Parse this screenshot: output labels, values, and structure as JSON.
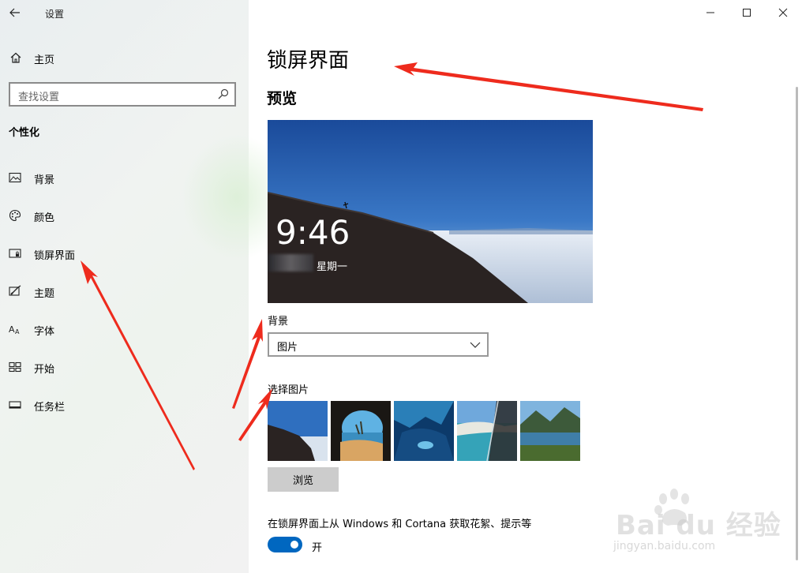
{
  "window": {
    "title": "设置",
    "back_glyph": "←",
    "controls": [
      "minimize-icon",
      "maximize-icon",
      "close-icon"
    ]
  },
  "sidebar": {
    "home_label": "主页",
    "search_placeholder": "查找设置",
    "section_title": "个性化",
    "items": [
      {
        "label": "背景",
        "icon": "picture-icon"
      },
      {
        "label": "颜色",
        "icon": "palette-icon"
      },
      {
        "label": "锁屏界面",
        "icon": "lockscreen-icon"
      },
      {
        "label": "主题",
        "icon": "theme-icon"
      },
      {
        "label": "字体",
        "icon": "font-icon"
      },
      {
        "label": "开始",
        "icon": "start-icon"
      },
      {
        "label": "任务栏",
        "icon": "taskbar-icon"
      }
    ]
  },
  "main": {
    "page_title": "锁屏界面",
    "preview_title": "预览",
    "preview": {
      "time": "9:46",
      "weekday": "星期一"
    },
    "background_label": "背景",
    "background_value": "图片",
    "choose_picture_label": "选择图片",
    "browse_button": "浏览",
    "tips_label": "在锁屏界面上从 Windows 和 Cortana 获取花絮、提示等",
    "tips_toggle_state": "开",
    "tips_toggle_on": true
  },
  "watermark": {
    "text": "Bai du 经验",
    "url": "jingyan.baidu.com"
  },
  "colors": {
    "accent": "#0067c0",
    "annotation_arrow": "#ee2b1d",
    "sidebar_bg": "#eef1f0"
  }
}
